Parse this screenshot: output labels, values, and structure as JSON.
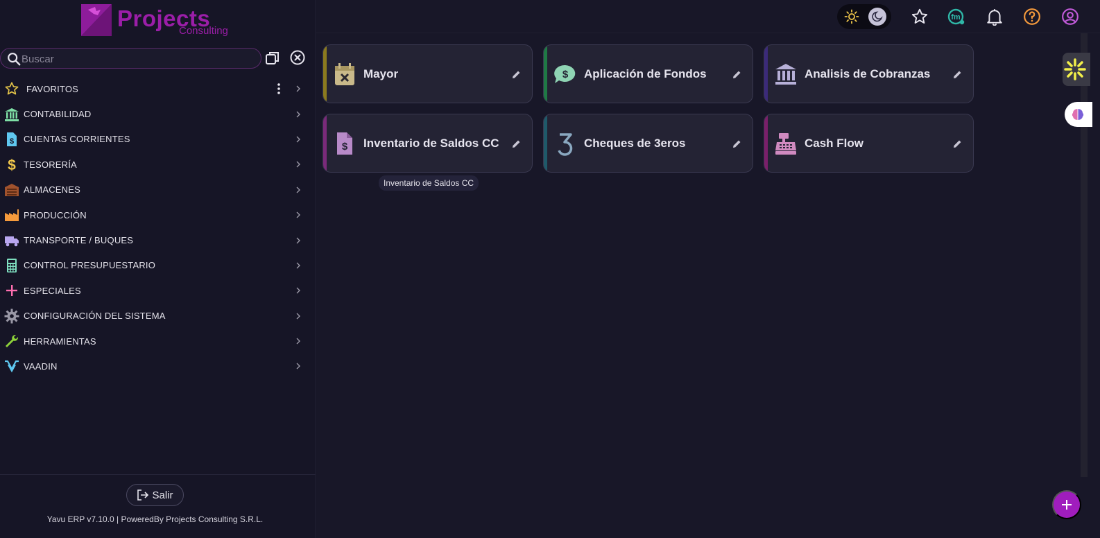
{
  "brand": {
    "name": "Projects",
    "sub": "Consulting"
  },
  "search": {
    "placeholder": "Buscar"
  },
  "menu": [
    {
      "label": "FAVORITOS",
      "icon": "star-icon"
    },
    {
      "label": "CONTABILIDAD",
      "icon": "bank-icon"
    },
    {
      "label": "CUENTAS CORRIENTES",
      "icon": "invoice-icon"
    },
    {
      "label": "TESORERÍA",
      "icon": "dollar-icon"
    },
    {
      "label": "ALMACENES",
      "icon": "warehouse-icon"
    },
    {
      "label": "PRODUCCIÓN",
      "icon": "factory-icon"
    },
    {
      "label": "TRANSPORTE / BUQUES",
      "icon": "truck-icon"
    },
    {
      "label": "CONTROL PRESUPUESTARIO",
      "icon": "calculator-icon"
    },
    {
      "label": "ESPECIALES",
      "icon": "plus-icon"
    },
    {
      "label": "CONFIGURACIÓN DEL SISTEMA",
      "icon": "gear-icon"
    },
    {
      "label": "HERRAMIENTAS",
      "icon": "wrench-icon"
    },
    {
      "label": "VAADIN",
      "icon": "vaadin-icon"
    }
  ],
  "footer": {
    "logout_label": "Salir",
    "version": "Yavu ERP v7.10.0 | PoweredBy Projects Consulting S.R.L."
  },
  "cards": [
    {
      "title": "Mayor",
      "icon": "calendar-x-icon",
      "accent": "#8b7a1e"
    },
    {
      "title": "Aplicación de Fondos",
      "icon": "money-chat-icon",
      "accent": "#1f7a45"
    },
    {
      "title": "Analisis de Cobranzas",
      "icon": "bank-icon",
      "accent": "#3b2a7a"
    },
    {
      "title": "Inventario de Saldos CC",
      "icon": "invoice-dollar-icon",
      "accent": "#7a2a7a"
    },
    {
      "title": "Cheques de 3eros",
      "icon": "number-three-icon",
      "accent": "#1f5a6a"
    },
    {
      "title": "Cash Flow",
      "icon": "cash-register-icon",
      "accent": "#7a1f6a"
    }
  ],
  "tooltip": "Inventario de Saldos CC",
  "colors": {
    "accent": "#a01dbd",
    "background": "#181728",
    "sidebar": "#161526"
  }
}
